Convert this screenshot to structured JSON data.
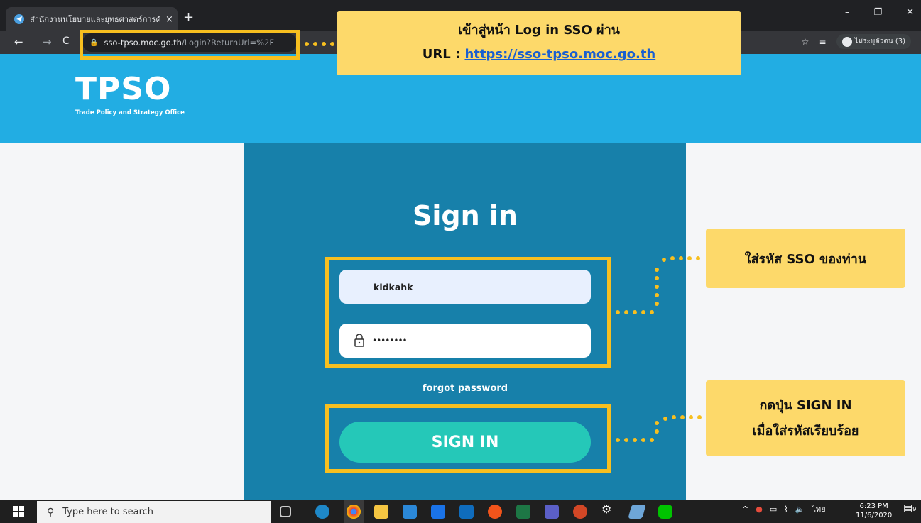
{
  "browser": {
    "tab_title": "สำนักงานนโยบายและยุทธศาสตร์การค้า",
    "tab_close": "×",
    "new_tab": "+",
    "url_host": "sso-tpso.moc.go.th",
    "url_path": "/Login?ReturnUrl=%2F",
    "profile_label": "ไม่ระบุตัวตน (3)",
    "window_controls": [
      "–",
      "❐",
      "✕"
    ]
  },
  "site": {
    "logo_text": "TPSO",
    "logo_subtitle": "Trade Policy and Strategy Office"
  },
  "login": {
    "title": "Sign in",
    "username_value": "kidkahk",
    "password_value": "••••••••",
    "forgot_label": "forgot password",
    "signin_button": "SIGN IN"
  },
  "annotations": {
    "url_note_line1": "เข้าสู่หน้า Log in SSO ผ่าน",
    "url_note_prefix": "URL : ",
    "url_note_link": "https://sso-tpso.moc.go.th",
    "sso_note": "ใส่รหัส SSO ของท่าน",
    "button_note_line1": "กดปุ่น SIGN IN",
    "button_note_line2": "เมื่อใส่รหัสเรียบร้อย",
    "highlight_color": "#f7bf1f",
    "note_color": "#fdd96a"
  },
  "taskbar": {
    "search_placeholder": "Type here to search",
    "language": "ไทย",
    "time": "6:23 PM",
    "date": "11/6/2020",
    "notification_count": "9"
  },
  "colors": {
    "header_blue": "#22ade3",
    "panel_blue": "#1780aa",
    "button_teal": "#25c8b8"
  }
}
